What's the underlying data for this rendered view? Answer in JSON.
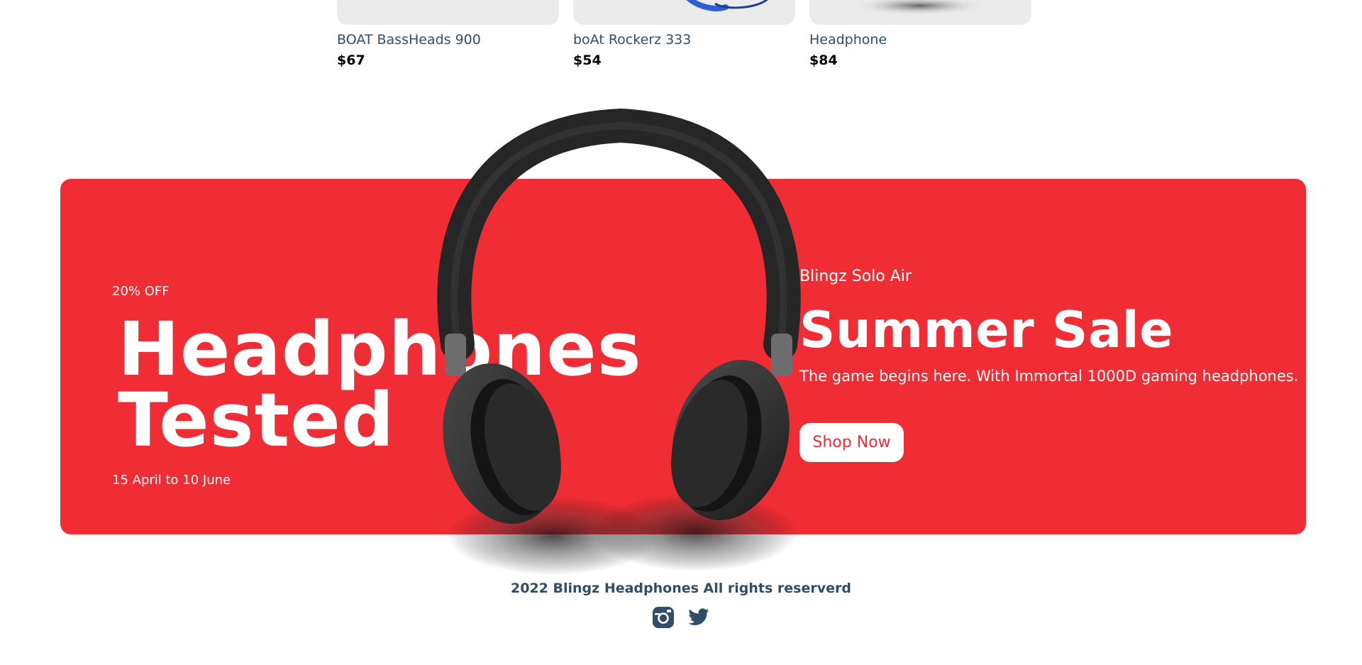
{
  "products": [
    {
      "name": "BOAT BassHeads 900",
      "price": "$67"
    },
    {
      "name": "boAt Rockerz 333",
      "price": "$54"
    },
    {
      "name": "Headphone",
      "price": "$84"
    }
  ],
  "banner": {
    "discount": "20% OFF",
    "large_text_1": "Headphones",
    "large_text_2": "Tested",
    "sale_time": "15 April to 10 June",
    "product": "Blingz Solo Air",
    "mid_text": "Summer Sale",
    "desc": "The game begins here. With Immortal 1000D gaming headphones.",
    "button_label": "Shop Now",
    "background_color": "#f02d34"
  },
  "footer": {
    "text": "2022 Blingz Headphones All rights reserverd",
    "icons": [
      "instagram-icon",
      "twitter-icon"
    ]
  }
}
